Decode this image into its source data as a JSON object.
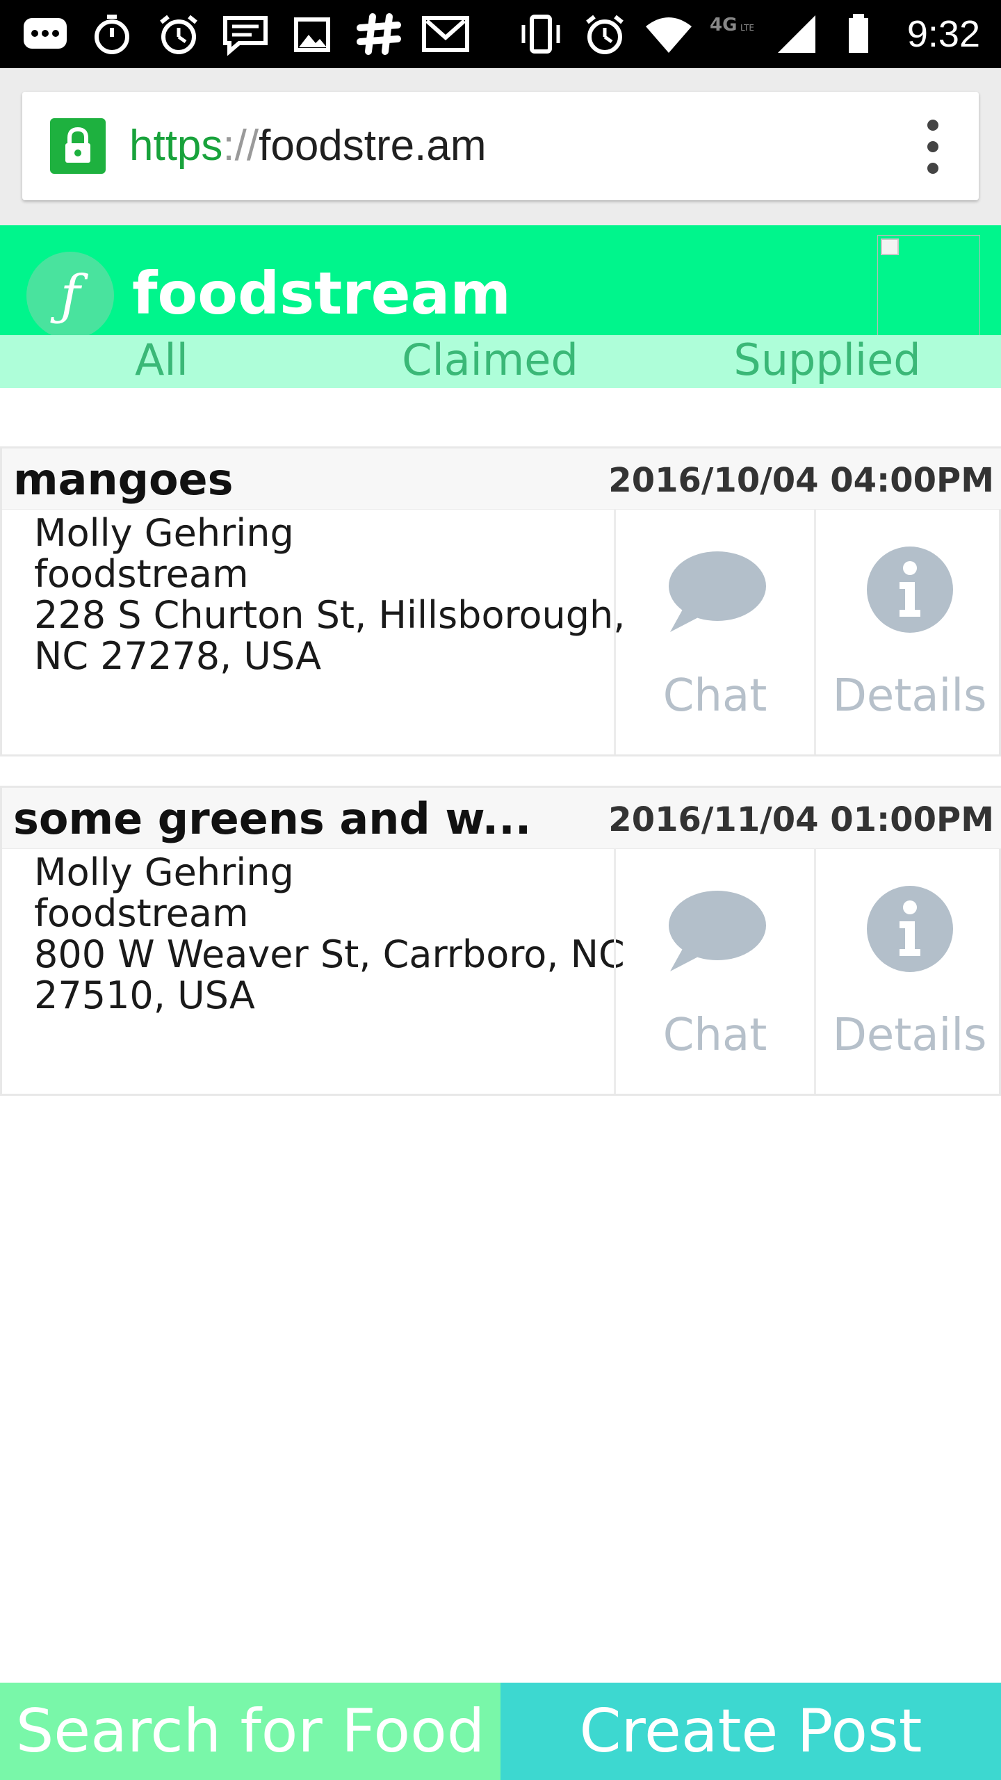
{
  "status_bar": {
    "time": "9:32",
    "network": "4G LTE",
    "left_icons": [
      "chat-bubble-icon",
      "stopwatch-icon",
      "alarm-icon",
      "sms-icon",
      "image-icon",
      "slack-icon",
      "gmail-icon"
    ],
    "right_icons": [
      "vibrate-icon",
      "alarm-icon",
      "wifi-icon",
      "signal-icon",
      "battery-icon"
    ]
  },
  "browser": {
    "url_scheme": "https",
    "url_sep": "://",
    "url_host": "foodstre.am",
    "secure_color": "#1eb13f"
  },
  "header": {
    "logo_glyph": "ƒ",
    "brand": "foodstream",
    "brand_color": "#00f58c"
  },
  "tabs": [
    {
      "label": "All"
    },
    {
      "label": "Claimed"
    },
    {
      "label": "Supplied"
    }
  ],
  "posts": [
    {
      "title": "mangoes",
      "date": "2016/10/04 04:00PM",
      "name": "Molly Gehring",
      "org": "foodstream",
      "address_line1": "228 S Churton St, Hillsborough,",
      "address_line2": "NC 27278, USA",
      "chat_label": "Chat",
      "details_label": "Details"
    },
    {
      "title": "some greens and w...",
      "date": "2016/11/04 01:00PM",
      "name": "Molly Gehring",
      "org": "foodstream",
      "address_line1": "800 W Weaver St, Carrboro, NC",
      "address_line2": "27510, USA",
      "chat_label": "Chat",
      "details_label": "Details"
    }
  ],
  "bottom": {
    "search_label": "Search for Food",
    "create_label": "Create Post",
    "search_color": "#79f7a9",
    "create_color": "#3dd8d0"
  }
}
